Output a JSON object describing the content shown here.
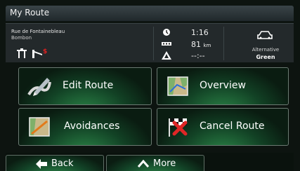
{
  "title": "My Route",
  "route": {
    "address_line1": "Rue de Fontainebleau",
    "address_line2": "Bombon",
    "time": "1:16",
    "distance_value": "81",
    "distance_unit": "km",
    "eta": "--:--",
    "route_type_label": "Alternative",
    "route_type_value": "Green"
  },
  "menu": {
    "edit_route": "Edit Route",
    "overview": "Overview",
    "avoidances": "Avoidances",
    "cancel_route": "Cancel Route"
  },
  "bottom": {
    "back": "Back",
    "more": "More"
  },
  "colors": {
    "background": "#0d1410",
    "panel": "#23292b",
    "button_glow": "#2d8a4a"
  }
}
